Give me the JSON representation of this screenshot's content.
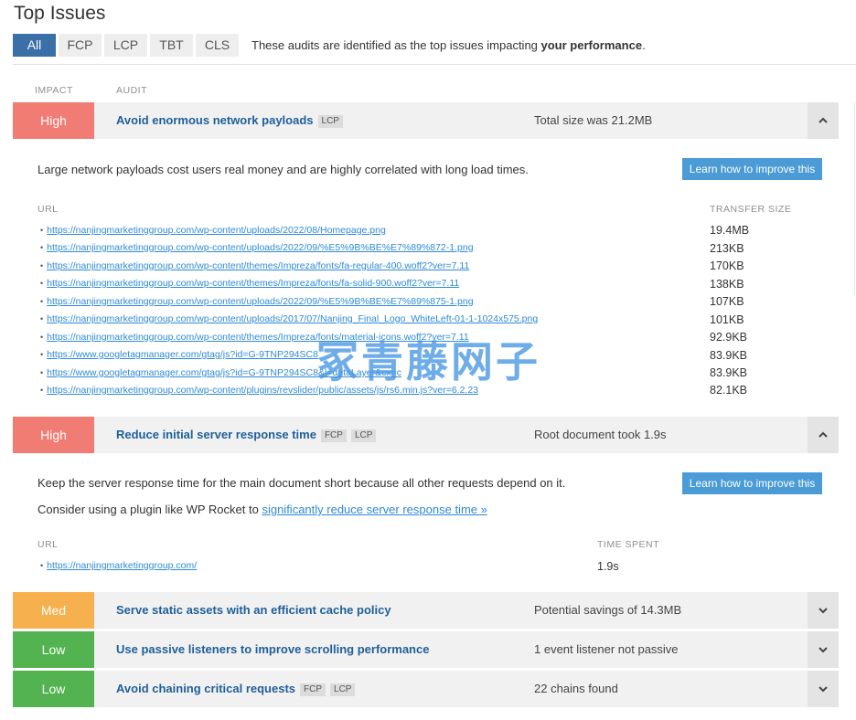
{
  "title": "Top Issues",
  "filters": {
    "buttons": [
      "All",
      "FCP",
      "LCP",
      "TBT",
      "CLS"
    ],
    "active": "All",
    "note_prefix": "These audits are identified as the top issues impacting ",
    "note_bold": "your performance",
    "note_suffix": "."
  },
  "columns": {
    "impact": "IMPACT",
    "audit": "AUDIT"
  },
  "audits": [
    {
      "impact": "High",
      "title": "Avoid enormous network payloads",
      "tags": [
        "LCP"
      ],
      "value": "Total size was 21.2MB",
      "expanded": true,
      "description": "Large network payloads cost users real money and are highly correlated with long load times.",
      "learn_label": "Learn how to improve this",
      "table": {
        "col1": "URL",
        "col2": "TRANSFER SIZE",
        "rows": [
          {
            "url": "https://nanjingmarketinggroup.com/wp-content/uploads/2022/08/Homepage.png",
            "size": "19.4MB"
          },
          {
            "url": "https://nanjingmarketinggroup.com/wp-content/uploads/2022/09/%E5%9B%BE%E7%89%872-1.png",
            "size": "213KB"
          },
          {
            "url": "https://nanjingmarketinggroup.com/wp-content/themes/Impreza/fonts/fa-regular-400.woff2?ver=7.11",
            "size": "170KB"
          },
          {
            "url": "https://nanjingmarketinggroup.com/wp-content/themes/Impreza/fonts/fa-solid-900.woff2?ver=7.11",
            "size": "138KB"
          },
          {
            "url": "https://nanjingmarketinggroup.com/wp-content/uploads/2022/09/%E5%9B%BE%E7%89%875-1.png",
            "size": "107KB"
          },
          {
            "url": "https://nanjingmarketinggroup.com/wp-content/uploads/2017/07/Nanjing_Final_Logo_WhiteLeft-01-1-1024x575.png",
            "size": "101KB"
          },
          {
            "url": "https://nanjingmarketinggroup.com/wp-content/themes/Impreza/fonts/material-icons.woff2?ver=7.11",
            "size": "92.9KB"
          },
          {
            "url": "https://www.googletagmanager.com/gtag/js?id=G-9TNP294SC8",
            "size": "83.9KB"
          },
          {
            "url": "https://www.googletagmanager.com/gtag/js?id=G-9TNP294SC8&l=dataLayer&cx=c",
            "size": "83.9KB"
          },
          {
            "url": "https://nanjingmarketinggroup.com/wp-content/plugins/revslider/public/assets/js/rs6.min.js?ver=6.2.23",
            "size": "82.1KB"
          }
        ]
      }
    },
    {
      "impact": "High",
      "title": "Reduce initial server response time",
      "tags": [
        "FCP",
        "LCP"
      ],
      "value": "Root document took 1.9s",
      "expanded": true,
      "description": "Keep the server response time for the main document short because all other requests depend on it.",
      "consider_prefix": "Consider using a plugin like WP Rocket to ",
      "consider_link": "significantly reduce server response time »",
      "learn_label": "Learn how to improve this",
      "table": {
        "col1": "URL",
        "col2": "TIME SPENT",
        "rows": [
          {
            "url": "https://nanjingmarketinggroup.com/",
            "size": "1.9s"
          }
        ]
      }
    },
    {
      "impact": "Med",
      "title": "Serve static assets with an efficient cache policy",
      "tags": [],
      "value": "Potential savings of 14.3MB",
      "expanded": false
    },
    {
      "impact": "Low",
      "title": "Use passive listeners to improve scrolling performance",
      "tags": [],
      "value": "1 event listener not passive",
      "expanded": false
    },
    {
      "impact": "Low",
      "title": "Avoid chaining critical requests",
      "tags": [
        "FCP",
        "LCP"
      ],
      "value": "22 chains found",
      "expanded": false
    }
  ],
  "watermark": "冢青藤网子",
  "icons": {
    "expanded": "chevron-up-icon",
    "collapsed": "chevron-down-icon"
  },
  "colors": {
    "high": "#f07c73",
    "med": "#f7b04e",
    "low": "#53b350",
    "accent": "#3a6fa7",
    "link": "#2e8ad6"
  }
}
